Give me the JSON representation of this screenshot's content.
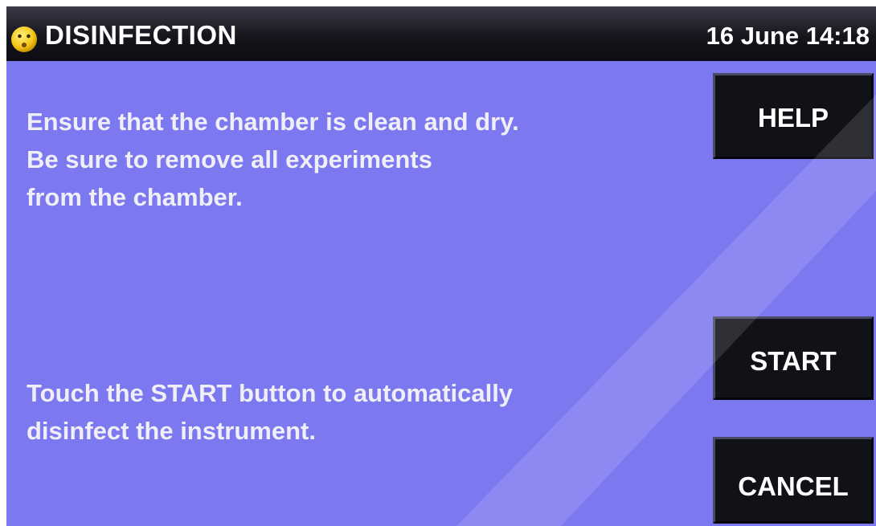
{
  "header": {
    "status_icon": "face-icon",
    "title": "DISINFECTION",
    "datetime": "16 June 14:18"
  },
  "content": {
    "instructions": [
      "Ensure that the chamber is clean and dry.",
      "Be sure to remove all experiments",
      "from the chamber."
    ],
    "start_hint": [
      "Touch the START button to automatically",
      "disinfect the instrument."
    ]
  },
  "buttons": {
    "help_label": "HELP",
    "start_label": "START",
    "cancel_label": "CANCEL"
  },
  "colors": {
    "background": "#7b78f0",
    "titlebar": "#15151c",
    "button": "#111218",
    "text": "#ffffff",
    "status_icon": "#f5c518"
  }
}
